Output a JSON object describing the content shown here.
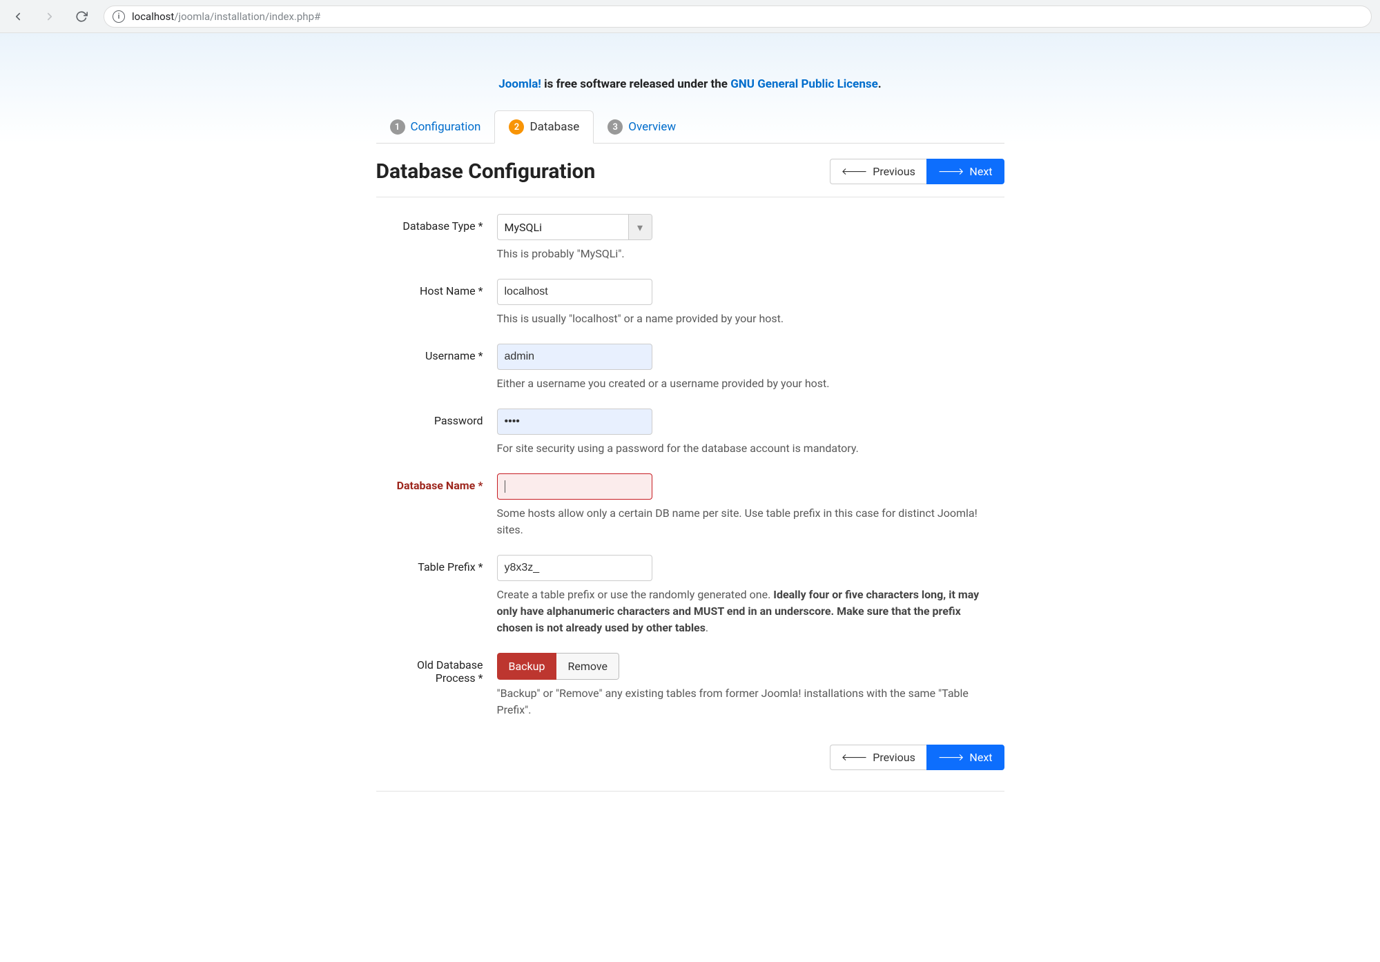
{
  "browser": {
    "url_host": "localhost",
    "url_path": "/joomla/installation/index.php#"
  },
  "intro": {
    "link1": "Joomla!",
    "mid": " is free software released under the ",
    "link2": "GNU General Public License",
    "end": "."
  },
  "tabs": [
    {
      "num": "1",
      "label": "Configuration"
    },
    {
      "num": "2",
      "label": "Database"
    },
    {
      "num": "3",
      "label": "Overview"
    }
  ],
  "page_title": "Database Configuration",
  "buttons": {
    "previous": "Previous",
    "next": "Next"
  },
  "form": {
    "db_type": {
      "label": "Database Type *",
      "value": "MySQLi",
      "help": "This is probably \"MySQLi\"."
    },
    "host_name": {
      "label": "Host Name *",
      "value": "localhost",
      "help": "This is usually \"localhost\" or a name provided by your host."
    },
    "username": {
      "label": "Username *",
      "value": "admin",
      "help": "Either a username you created or a username provided by your host."
    },
    "password": {
      "label": "Password",
      "value": "••••",
      "help": "For site security using a password for the database account is mandatory."
    },
    "db_name": {
      "label": "Database Name *",
      "value": "",
      "help": "Some hosts allow only a certain DB name per site. Use table prefix in this case for distinct Joomla! sites."
    },
    "table_prefix": {
      "label": "Table Prefix *",
      "value": "y8x3z_",
      "help_pre": "Create a table prefix or use the randomly generated one. ",
      "help_bold": "Ideally four or five characters long, it may only have alphanumeric characters and MUST end in an underscore. Make sure that the prefix chosen is not already used by other tables",
      "help_post": "."
    },
    "old_db": {
      "label": "Old Database Process *",
      "options": {
        "backup": "Backup",
        "remove": "Remove"
      },
      "help": "\"Backup\" or \"Remove\" any existing tables from former Joomla! installations with the same \"Table Prefix\"."
    }
  }
}
